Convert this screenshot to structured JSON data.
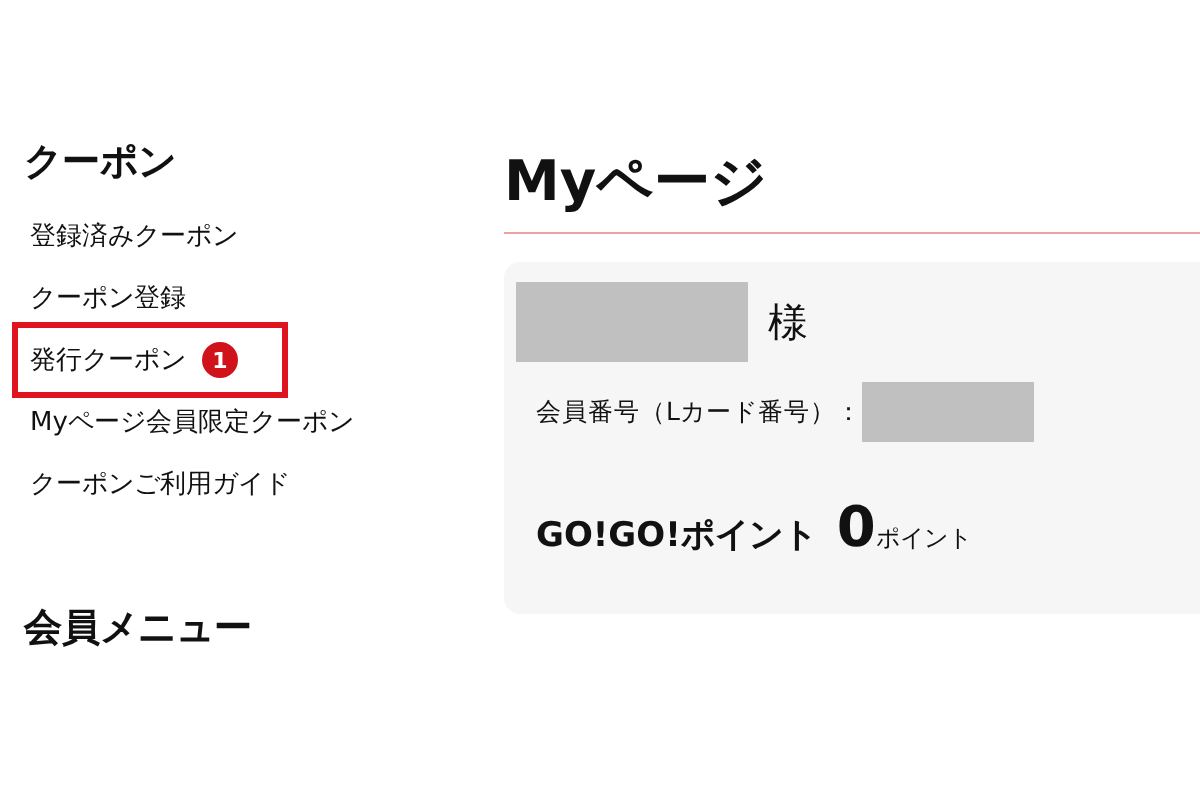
{
  "sidebar": {
    "sections": [
      {
        "title": "クーポン",
        "items": [
          {
            "label": "登録済みクーポン",
            "highlighted": false
          },
          {
            "label": "クーポン登録",
            "highlighted": false
          },
          {
            "label": "発行クーポン",
            "highlighted": true,
            "badge": "1"
          },
          {
            "label": "Myページ会員限定クーポン",
            "highlighted": false
          },
          {
            "label": "クーポンご利用ガイド",
            "highlighted": false
          }
        ]
      },
      {
        "title": "会員メニュー"
      }
    ]
  },
  "main": {
    "title": "Myページ",
    "card": {
      "honorific": "様",
      "member_number_label": "会員番号（Lカード番号）：",
      "points_label": "GO!GO!ポイント",
      "points_value": "0",
      "points_unit": "ポイント"
    }
  }
}
